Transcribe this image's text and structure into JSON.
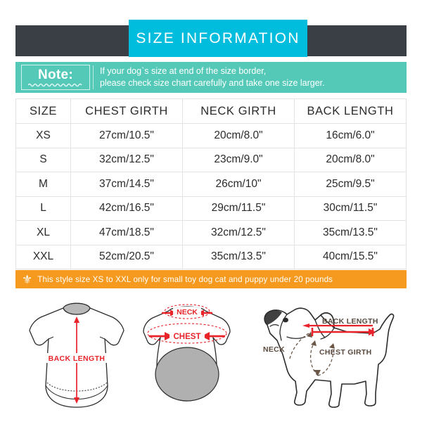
{
  "header": {
    "title": "SIZE INFORMATION",
    "band_color": "#3a3f45",
    "title_bg_color": "#00bcdd"
  },
  "note": {
    "badge_label": "Note:",
    "text": "If your dog`s size at end of the size border,\nplease check size chart carefully and take one size larger.",
    "bg_color": "#54c9b8"
  },
  "table": {
    "columns": [
      "SIZE",
      "CHEST GIRTH",
      "NECK GIRTH",
      "BACK LENGTH"
    ],
    "rows": [
      {
        "size": "XS",
        "chest": "27cm/10.5\"",
        "neck": "20cm/8.0\"",
        "back": "16cm/6.0\""
      },
      {
        "size": "S",
        "chest": "32cm/12.5\"",
        "neck": "23cm/9.0\"",
        "back": "20cm/8.0\""
      },
      {
        "size": "M",
        "chest": "37cm/14.5\"",
        "neck": "26cm/10\"",
        "back": "25cm/9.5\""
      },
      {
        "size": "L",
        "chest": "42cm/16.5\"",
        "neck": "29cm/11.5\"",
        "back": "30cm/11.5\""
      },
      {
        "size": "XL",
        "chest": "47cm/18.5\"",
        "neck": "32cm/12.5\"",
        "back": "35cm/13.5\""
      },
      {
        "size": "XXL",
        "chest": "52cm/20.5\"",
        "neck": "35cm/13.5\"",
        "back": "40cm/15.5\""
      }
    ]
  },
  "banner": {
    "icon": "fleur-de-lis-icon",
    "icon_glyph": "⚜",
    "text": "This style size XS to XXL only for small toy dog cat and puppy under 20 pounds",
    "bg_color": "#f59a1e"
  },
  "diagrams": {
    "garment_front": {
      "label_back_length": "BACK LENGTH"
    },
    "garment_top": {
      "label_neck": "NECK",
      "label_chest": "CHEST"
    },
    "dog": {
      "label_back_length": "BACK LENGTH",
      "label_neck": "NECK",
      "label_chest_girth": "CHEST GIRTH"
    },
    "arrow_color": "#e8232a",
    "dog_label_color": "#5a4a3f"
  }
}
